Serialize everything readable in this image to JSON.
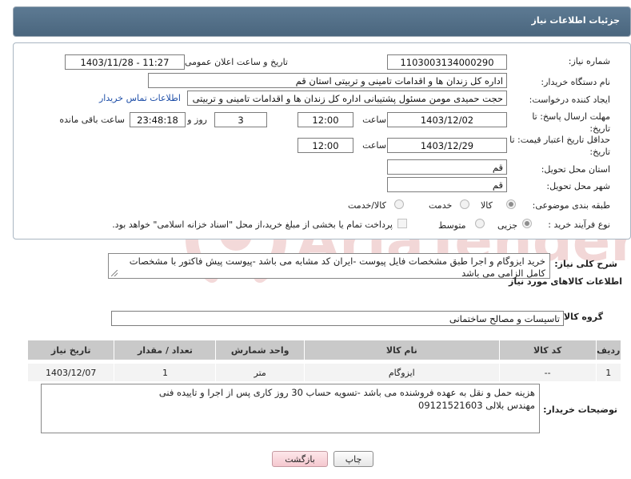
{
  "header": {
    "title": "جزئیات اطلاعات نیاز"
  },
  "form": {
    "need_number": {
      "label": "شماره نیاز:",
      "value": "1103003134000290"
    },
    "announce_datetime": {
      "label": "تاریخ و ساعت اعلان عمومی:",
      "value": "1403/11/28 - 11:27"
    },
    "buyer_org": {
      "label": "نام دستگاه خریدار:",
      "value": "اداره کل زندان ها و اقدامات تامینی و تربیتی استان قم"
    },
    "requester": {
      "label": "ایجاد کننده درخواست:",
      "value": "حجت  حمیدی مومن مسئول پشتیبانی اداره کل زندان ها و اقدامات تامینی و تربیتی",
      "contact_link": "اطلاعات تماس خریدار"
    },
    "reply_deadline": {
      "label": "مهلت ارسال پاسخ: تا تاریخ:",
      "date": "1403/12/02",
      "time_label": "ساعت",
      "time": "12:00",
      "days": "3",
      "days_label": "روز و",
      "remaining": "23:48:18",
      "remaining_label": "ساعت باقی مانده"
    },
    "price_validity": {
      "label": "حداقل تاریخ اعتبار قیمت: تا تاریخ:",
      "date": "1403/12/29",
      "time_label": "ساعت",
      "time": "12:00"
    },
    "delivery_province": {
      "label": "استان محل تحویل:",
      "value": "قم"
    },
    "delivery_city": {
      "label": "شهر محل تحویل:",
      "value": "قم"
    },
    "category": {
      "label": "طبقه بندی موضوعی:",
      "options": [
        "کالا",
        "خدمت",
        "کالا/خدمت"
      ],
      "selected": "کالا"
    },
    "purchase_process": {
      "label": "نوع فرآیند خرید :",
      "options": [
        "جزیی",
        "متوسط"
      ],
      "selected": "جزیی",
      "payment_note": "پرداخت تمام یا بخشی از مبلغ خرید،از محل \"اسناد خزانه اسلامی\" خواهد بود."
    }
  },
  "need_description": {
    "label": "شرح کلی نیاز:",
    "text": "خرید ایزوگام  و اجرا طبق مشخصات فایل پیوست -ایران کد مشابه می باشد -پیوست پیش فاکتور با مشخصات کامل الزامی می باشد"
  },
  "goods_section": {
    "title": "اطلاعات کالاهای مورد نیاز",
    "group_label": "گروه کالا:",
    "group_value": "تاسیسات و مصالح ساختمانی",
    "table": {
      "headers": [
        "ردیف",
        "کد کالا",
        "نام کالا",
        "واحد شمارش",
        "تعداد / مقدار",
        "تاریخ نیاز"
      ],
      "rows": [
        [
          "1",
          "--",
          "ایزوگام",
          "متر",
          "1",
          "1403/12/07"
        ]
      ]
    }
  },
  "buyer_notes": {
    "label": "توضیحات خریدار:",
    "line1": "هزینه حمل و نقل به عهده فروشنده می باشد -تسویه حساب 30 روز کاری پس از اجرا و تاییده فنی",
    "line2": "مهندس بلالی 09121521603"
  },
  "buttons": {
    "print": "چاپ",
    "back": "بازگشت"
  },
  "watermark": {
    "text": "AriaTender.neT"
  },
  "colors": {
    "header_bg": "#4f6c84",
    "accent_link": "#1f4fa8",
    "table_header_bg": "#c9c9c9",
    "back_button_bg": "#f5c8cf",
    "watermark": "#f2d7d7"
  }
}
